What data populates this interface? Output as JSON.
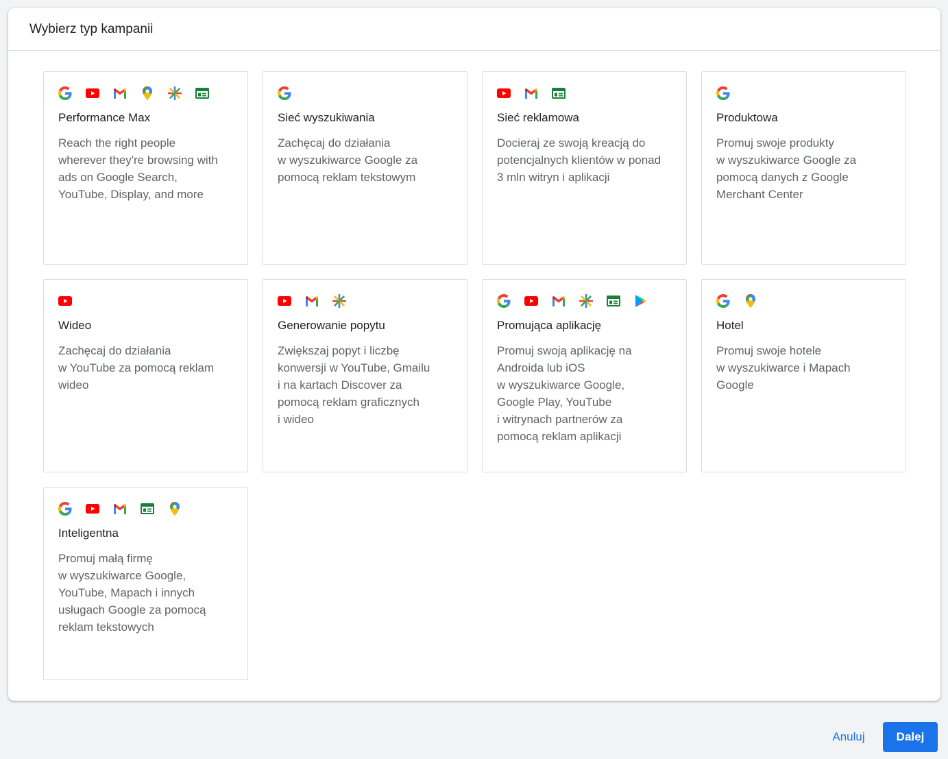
{
  "dialog": {
    "title": "Wybierz typ kampanii"
  },
  "cards": [
    {
      "title": "Performance Max",
      "description": "Reach the right people\nwherever they're browsing with\nads on Google Search,\nYouTube, Display, and more",
      "icons": [
        "google-icon",
        "youtube-icon",
        "gmail-icon",
        "maps-icon",
        "discover-icon",
        "display-icon"
      ]
    },
    {
      "title": "Sieć wyszukiwania",
      "description": "Zachęcaj do działania\nw wyszukiwarce Google za\npomocą reklam tekstowym",
      "icons": [
        "google-icon"
      ]
    },
    {
      "title": "Sieć reklamowa",
      "description": "Docieraj ze swoją kreacją do\npotencjalnych klientów w ponad\n3 mln witryn i aplikacji",
      "icons": [
        "youtube-icon",
        "gmail-icon",
        "display-icon"
      ]
    },
    {
      "title": "Produktowa",
      "description": "Promuj swoje produkty\nw wyszukiwarce Google za\npomocą danych z Google\nMerchant Center",
      "icons": [
        "google-icon"
      ]
    },
    {
      "title": "Wideo",
      "description": "Zachęcaj do działania\nw YouTube za pomocą reklam\nwideo",
      "icons": [
        "youtube-icon"
      ]
    },
    {
      "title": "Generowanie popytu",
      "description": "Zwiększaj popyt i liczbę\nkonwersji w YouTube, Gmailu\ni na kartach Discover za\npomocą reklam graficznych\ni wideo",
      "icons": [
        "youtube-icon",
        "gmail-icon",
        "discover-icon"
      ]
    },
    {
      "title": "Promująca aplikację",
      "description": "Promuj swoją aplikację na\nAndroida lub iOS\nw wyszukiwarce Google,\nGoogle Play, YouTube\ni witrynach partnerów za\npomocą reklam aplikacji",
      "icons": [
        "google-icon",
        "youtube-icon",
        "gmail-icon",
        "discover-icon",
        "display-icon",
        "play-icon"
      ]
    },
    {
      "title": "Hotel",
      "description": "Promuj swoje hotele\nw wyszukiwarce i Mapach\nGoogle",
      "icons": [
        "google-icon",
        "maps-icon"
      ]
    },
    {
      "title": "Inteligentna",
      "description": "Promuj małą firmę\nw wyszukiwarce Google,\nYouTube, Mapach i innych\nusługach Google za pomocą\nreklam tekstowych",
      "icons": [
        "google-icon",
        "youtube-icon",
        "gmail-icon",
        "display-icon",
        "maps-icon"
      ]
    }
  ],
  "footer": {
    "cancel_label": "Anuluj",
    "next_label": "Dalej"
  },
  "colors": {
    "primary": "#1a73e8",
    "border": "#dadce0",
    "background": "#f1f3f4"
  }
}
